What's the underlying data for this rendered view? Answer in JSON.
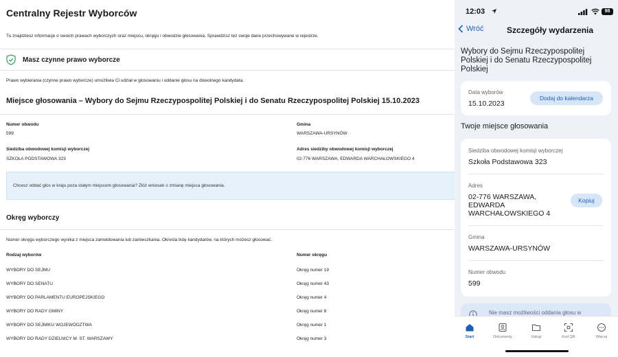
{
  "web": {
    "title": "Centralny Rejestr Wyborców",
    "intro": "Tu znajdziesz informacje o swoich prawach wyborczych oraz miejscu, okręgu i obwodzie głosowania. Sprawdzisz też swoje dane przechowywane w rejestrze.",
    "voting_right": {
      "icon": "shield-check-icon",
      "label": "Masz czynne prawo wyborcze",
      "description": "Prawo wybierania (czynne prawo wyborcze) umożliwia Ci udział w głosowaniu i oddanie głosu na dowolnego kandydata."
    },
    "location": {
      "heading": "Miejsce głosowania – Wybory do Sejmu Rzeczypospolitej Polskiej i do Senatu Rzeczypospolitej Polskiej 15.10.2023",
      "fields": {
        "district_number": {
          "label": "Numer obwodu",
          "value": "599"
        },
        "municipality": {
          "label": "Gmina",
          "value": "WARSZAWA-URSYNÓW"
        },
        "commission_seat": {
          "label": "Siedziba obwodowej komisji wyborczej",
          "value": "SZKOŁA PODSTAWOWA 323"
        },
        "commission_address": {
          "label": "Adres siedziby obwodowej komisji wyborczej",
          "value": "02-776 WARSZAWA, EDWARDA WARCHAŁOWSKIEGO 4"
        }
      },
      "info": "Chcesz oddać głos w kraju poza stałym miejscem głosowania? Złóż wniosek o zmianę miejsca głosowania."
    },
    "district": {
      "heading": "Okręg wyborczy",
      "description": "Numer okręgu wyborczego wynika z miejsca zameldowania lub zamieszkania. Określa listę kandydatów, na których możesz głosować.",
      "columns": [
        "Rodzaj wyborów",
        "Numer okręgu"
      ],
      "rows": [
        [
          "WYBORY DO SEJMU",
          "Okręg numer 19"
        ],
        [
          "WYBORY DO SENATU",
          "Okręg numer 43"
        ],
        [
          "WYBORY DO PARLAMENTU EUROPEJSKIEGO",
          "Okręg numer 4"
        ],
        [
          "WYBORY DO RADY GMINY",
          "Okręg numer 8"
        ],
        [
          "WYBORY DO SEJMIKU WOJEWÓDZTWA",
          "Okręg numer 1"
        ],
        [
          "WYBORY DO RADY DZIELNICY M. ST. WARSZAWY",
          "Okręg numer 3"
        ]
      ]
    }
  },
  "phone": {
    "status": {
      "time": "12:03",
      "battery": "98"
    },
    "nav": {
      "back_label": "Wróć",
      "title": "Szczegóły wydarzenia"
    },
    "event_title": "Wybory do Sejmu Rzeczypospolitej Polskiej i do Senatu Rzeczypospolitej Polskiej",
    "date_card": {
      "label": "Data wyborów",
      "value": "15.10.2023",
      "button": "Dodaj do kalendarza"
    },
    "place_heading": "Twoje miejsce głosowania",
    "place_card": {
      "seat_label": "Siedziba obwodowej komisji wyborczej",
      "seat_value": "Szkoła Podstawowa 323",
      "address_label": "Adres",
      "address_lines": [
        "02-776 WARSZAWA,",
        "EDWARDA",
        "WARCHAŁOWSKIEGO 4"
      ],
      "copy_button": "Kopiuj",
      "municipality_label": "Gmina",
      "municipality_value": "WARSZAWA-URSYNÓW",
      "district_label": "Numer obwodu",
      "district_value": "599"
    },
    "notice": "Nie masz możliwości oddania głosu w",
    "tabs": [
      {
        "label": "Start",
        "icon": "home-icon",
        "active": true
      },
      {
        "label": "Dokumenty",
        "icon": "documents-icon",
        "active": false
      },
      {
        "label": "Usługi",
        "icon": "folder-icon",
        "active": false
      },
      {
        "label": "Kod QR",
        "icon": "qr-code-icon",
        "active": false
      },
      {
        "label": "Więcej",
        "icon": "more-icon",
        "active": false
      }
    ],
    "colors": {
      "accent": "#1d5fb4",
      "background": "#eef2f8",
      "pill": "#d6e6f7"
    }
  }
}
